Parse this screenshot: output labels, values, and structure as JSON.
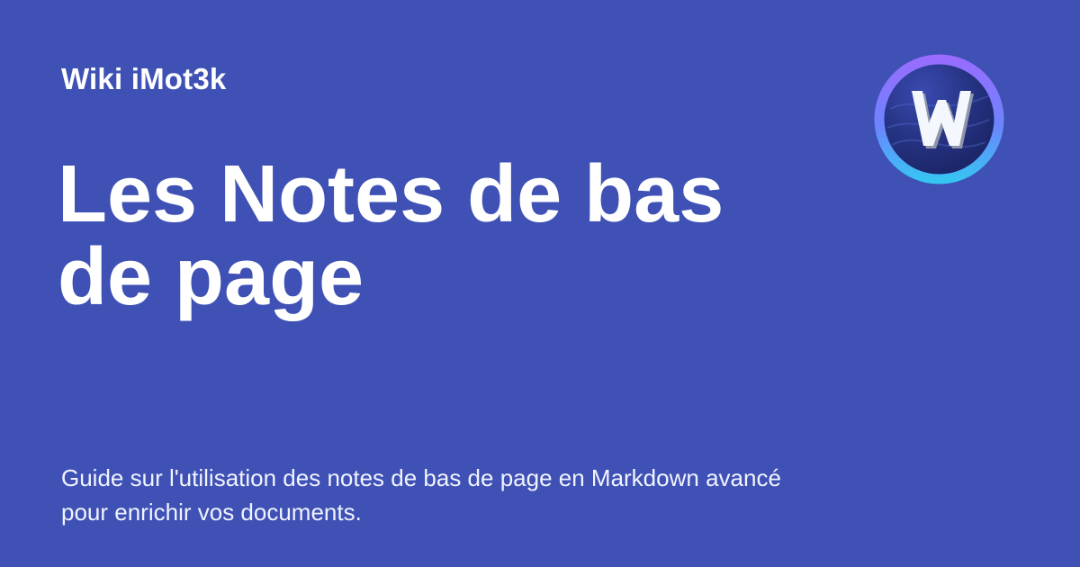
{
  "colors": {
    "background": "#3f51b5",
    "text": "#ffffff",
    "logo_ring_top": "#9b6bff",
    "logo_ring_bottom": "#33c9f2",
    "logo_inner": "#24317f"
  },
  "header": {
    "site_name": "Wiki iMot3k",
    "logo_icon": "wiki-w-logo-icon"
  },
  "main": {
    "title": "Les Notes de bas de page",
    "description": "Guide sur l'utilisation des notes de bas de page en Markdown avancé pour enrichir vos documents."
  }
}
